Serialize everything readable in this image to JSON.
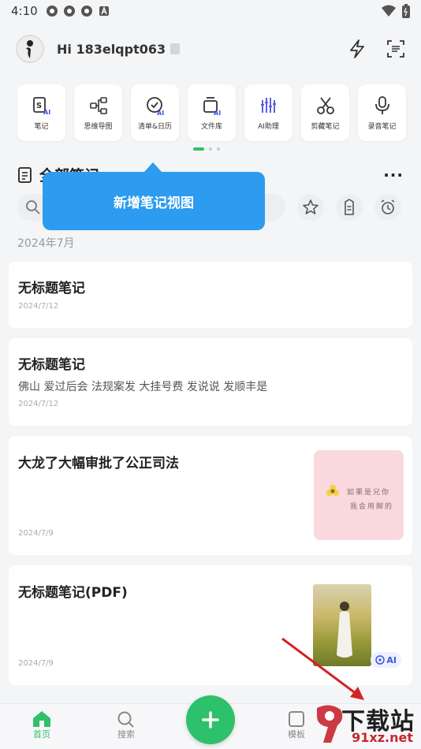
{
  "status": {
    "time": "4:10"
  },
  "header": {
    "greeting": "Hi 183elqpt063"
  },
  "quick_actions": [
    {
      "label": "笔记",
      "icon": "note-ai-icon"
    },
    {
      "label": "思维导图",
      "icon": "mindmap-icon"
    },
    {
      "label": "清单&日历",
      "icon": "checklist-ai-icon"
    },
    {
      "label": "文件库",
      "icon": "file-library-icon"
    },
    {
      "label": "AI助理",
      "icon": "ai-assistant-icon"
    },
    {
      "label": "剪藏笔记",
      "icon": "scissors-icon"
    },
    {
      "label": "录音笔记",
      "icon": "microphone-icon"
    }
  ],
  "section": {
    "title": "全部笔记"
  },
  "tooltip": {
    "text": "新增笔记视图"
  },
  "month_header": "2024年7月",
  "notes": [
    {
      "title": "无标题笔记",
      "snippet": "",
      "date": "2024/7/12"
    },
    {
      "title": "无标题笔记",
      "snippet": "佛山 爱过后会 法规案发 大挂号费 发说说 发顺丰是",
      "date": "2024/7/12"
    },
    {
      "title": "大龙了大幅审批了公正司法",
      "snippet": "",
      "date": "2024/7/9",
      "thumb_text_1": "如果是兄你",
      "thumb_text_2": "我会用脚的"
    },
    {
      "title": "无标题笔记(PDF)",
      "snippet": "",
      "date": "2024/7/9",
      "badge": "AI"
    }
  ],
  "bottom_nav": {
    "home": "首页",
    "search": "搜索",
    "template": "模板"
  },
  "watermark": {
    "big": "下载站",
    "small": "91xz.net"
  },
  "colors": {
    "accent": "#2ec16b",
    "tooltip": "#2d9bef",
    "arrow": "#d42323"
  }
}
